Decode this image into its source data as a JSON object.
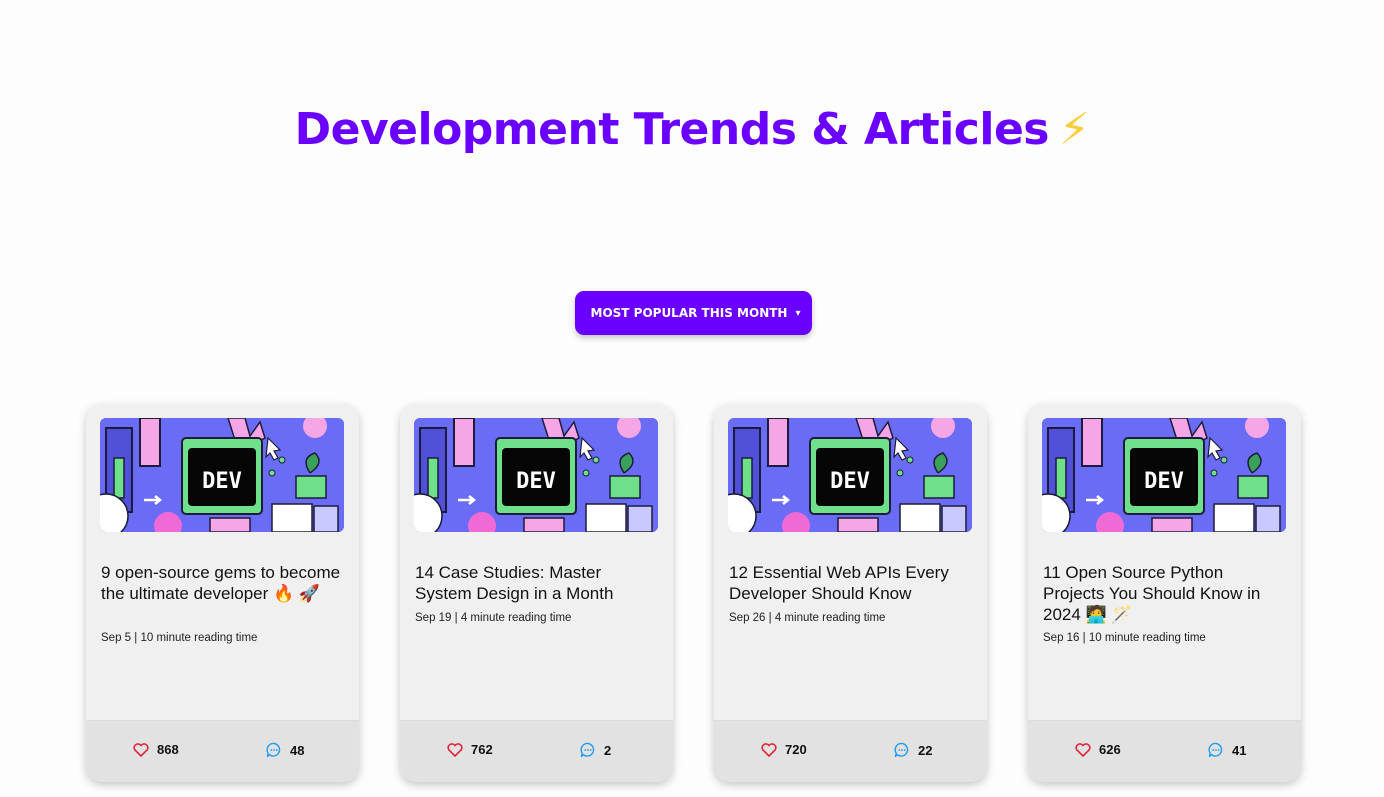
{
  "page": {
    "title": "Development Trends & Articles",
    "title_emoji": "⚡"
  },
  "filter": {
    "selected": "MOST POPULAR THIS MONTH",
    "chevron": "▾"
  },
  "thumbnail": {
    "logo_text": "DEV",
    "colors": {
      "bg": "#6b6cf5",
      "screen": "#6fe08a",
      "pink": "#f6a6e6"
    }
  },
  "icons": {
    "likes": "heart-icon",
    "comments": "comment-icon"
  },
  "colors": {
    "accent": "#6a00ff",
    "heart": "#e0243a",
    "comment": "#1d9bf0"
  },
  "articles": [
    {
      "title": "9 open-source gems to become the ultimate developer 🔥 🚀",
      "date": "Sep 5",
      "reading_time": "10 minute reading time",
      "likes": "868",
      "comments": "48"
    },
    {
      "title": "14 Case Studies: Master System Design in a Month",
      "date": "Sep 19",
      "reading_time": "4 minute reading time",
      "likes": "762",
      "comments": "2"
    },
    {
      "title": "12 Essential Web APIs Every Developer Should Know",
      "date": "Sep 26",
      "reading_time": "4 minute reading time",
      "likes": "720",
      "comments": "22"
    },
    {
      "title": "11 Open Source Python Projects You Should Know in 2024 🧑‍💻 🪄",
      "date": "Sep 16",
      "reading_time": "10 minute reading time",
      "likes": "626",
      "comments": "41"
    }
  ]
}
